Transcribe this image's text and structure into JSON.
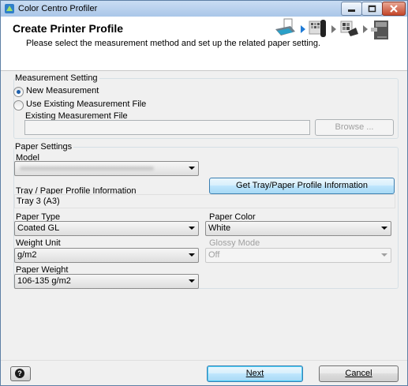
{
  "window": {
    "title": "Color Centro Profiler"
  },
  "header": {
    "title": "Create Printer Profile",
    "subtitle": "Please select the measurement method and set up the related paper setting.",
    "wizard_steps": [
      "printer-paper-icon",
      "arrow",
      "measurement-device-icon",
      "arrow",
      "color-chart-icon",
      "arrow",
      "output-printer-icon"
    ],
    "active_arrow_color": "#1f7bd6"
  },
  "measurement": {
    "group_label": "Measurement Setting",
    "new_label": "New Measurement",
    "new_selected": true,
    "existing_label": "Use Existing Measurement File",
    "existing_selected": false,
    "file_label": "Existing Measurement File",
    "file_value": "",
    "browse_label": "Browse ..."
  },
  "paper": {
    "group_label": "Paper Settings",
    "model_label": "Model",
    "model_value": "",
    "get_info_label": "Get Tray/Paper Profile Information",
    "tray_label": "Tray / Paper Profile Information",
    "tray_value": "Tray 3 (A3)",
    "type_label": "Paper Type",
    "type_value": "Coated GL",
    "color_label": "Paper Color",
    "color_value": "White",
    "weight_unit_label": "Weight Unit",
    "weight_unit_value": "g/m2",
    "glossy_label": "Glossy Mode",
    "glossy_value": "Off",
    "weight_label": "Paper Weight",
    "weight_value": "106-135 g/m2"
  },
  "footer": {
    "help_label": "?",
    "next_label": "Next",
    "cancel_label": "Cancel"
  }
}
